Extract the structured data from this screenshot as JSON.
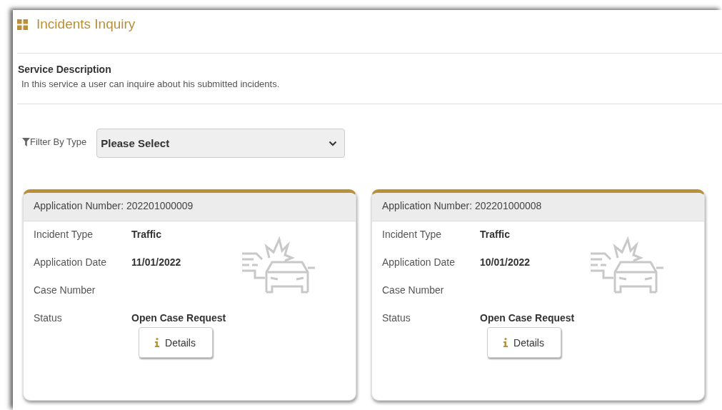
{
  "page": {
    "title": "Incidents Inquiry"
  },
  "service": {
    "heading": "Service Description",
    "description": "In this service a user can inquire about his submitted incidents."
  },
  "filter": {
    "label": "Filter By Type",
    "value": "Please Select"
  },
  "applications": [
    {
      "header": "Application Number: 202201000009",
      "fields": [
        {
          "label": "Incident Type",
          "value": "Traffic"
        },
        {
          "label": "Application Date",
          "value": "11/01/2022"
        },
        {
          "label": "Case Number"
        },
        {
          "label": "Status",
          "value": "Open Case Request"
        }
      ],
      "button": "Details"
    },
    {
      "header": "Application Number: 202201000008",
      "fields": [
        {
          "label": "Incident Type",
          "value": "Traffic"
        },
        {
          "label": "Application Date",
          "value": "10/01/2022"
        },
        {
          "label": "Case Number"
        },
        {
          "label": "Status",
          "value": "Open Case Request"
        }
      ],
      "button": "Details"
    }
  ]
}
